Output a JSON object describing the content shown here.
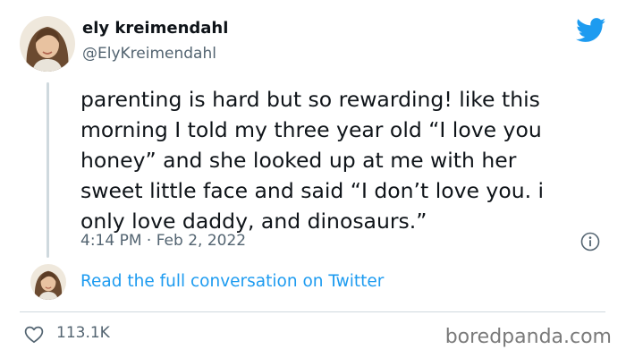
{
  "author": {
    "display_name": "ely kreimendahl",
    "handle": "@ElyKreimendahl"
  },
  "brand": {
    "logo_icon": "twitter-bird-icon",
    "accent_color": "#1d9bf0"
  },
  "tweet": {
    "lines": [
      "parenting is hard but so rewarding! like this",
      "morning I told my three year old “I love you",
      "honey” and she looked up at me with her",
      "sweet little face and said “I don’t love you. i",
      "only love daddy, and dinosaurs.”"
    ],
    "timestamp": "4:14 PM · Feb 2, 2022"
  },
  "actions": {
    "read_conversation_label": "Read the full conversation on Twitter",
    "like_count": "113.1K",
    "like_icon": "heart-icon",
    "info_icon": "info-icon"
  },
  "watermark": "boredpanda.com"
}
